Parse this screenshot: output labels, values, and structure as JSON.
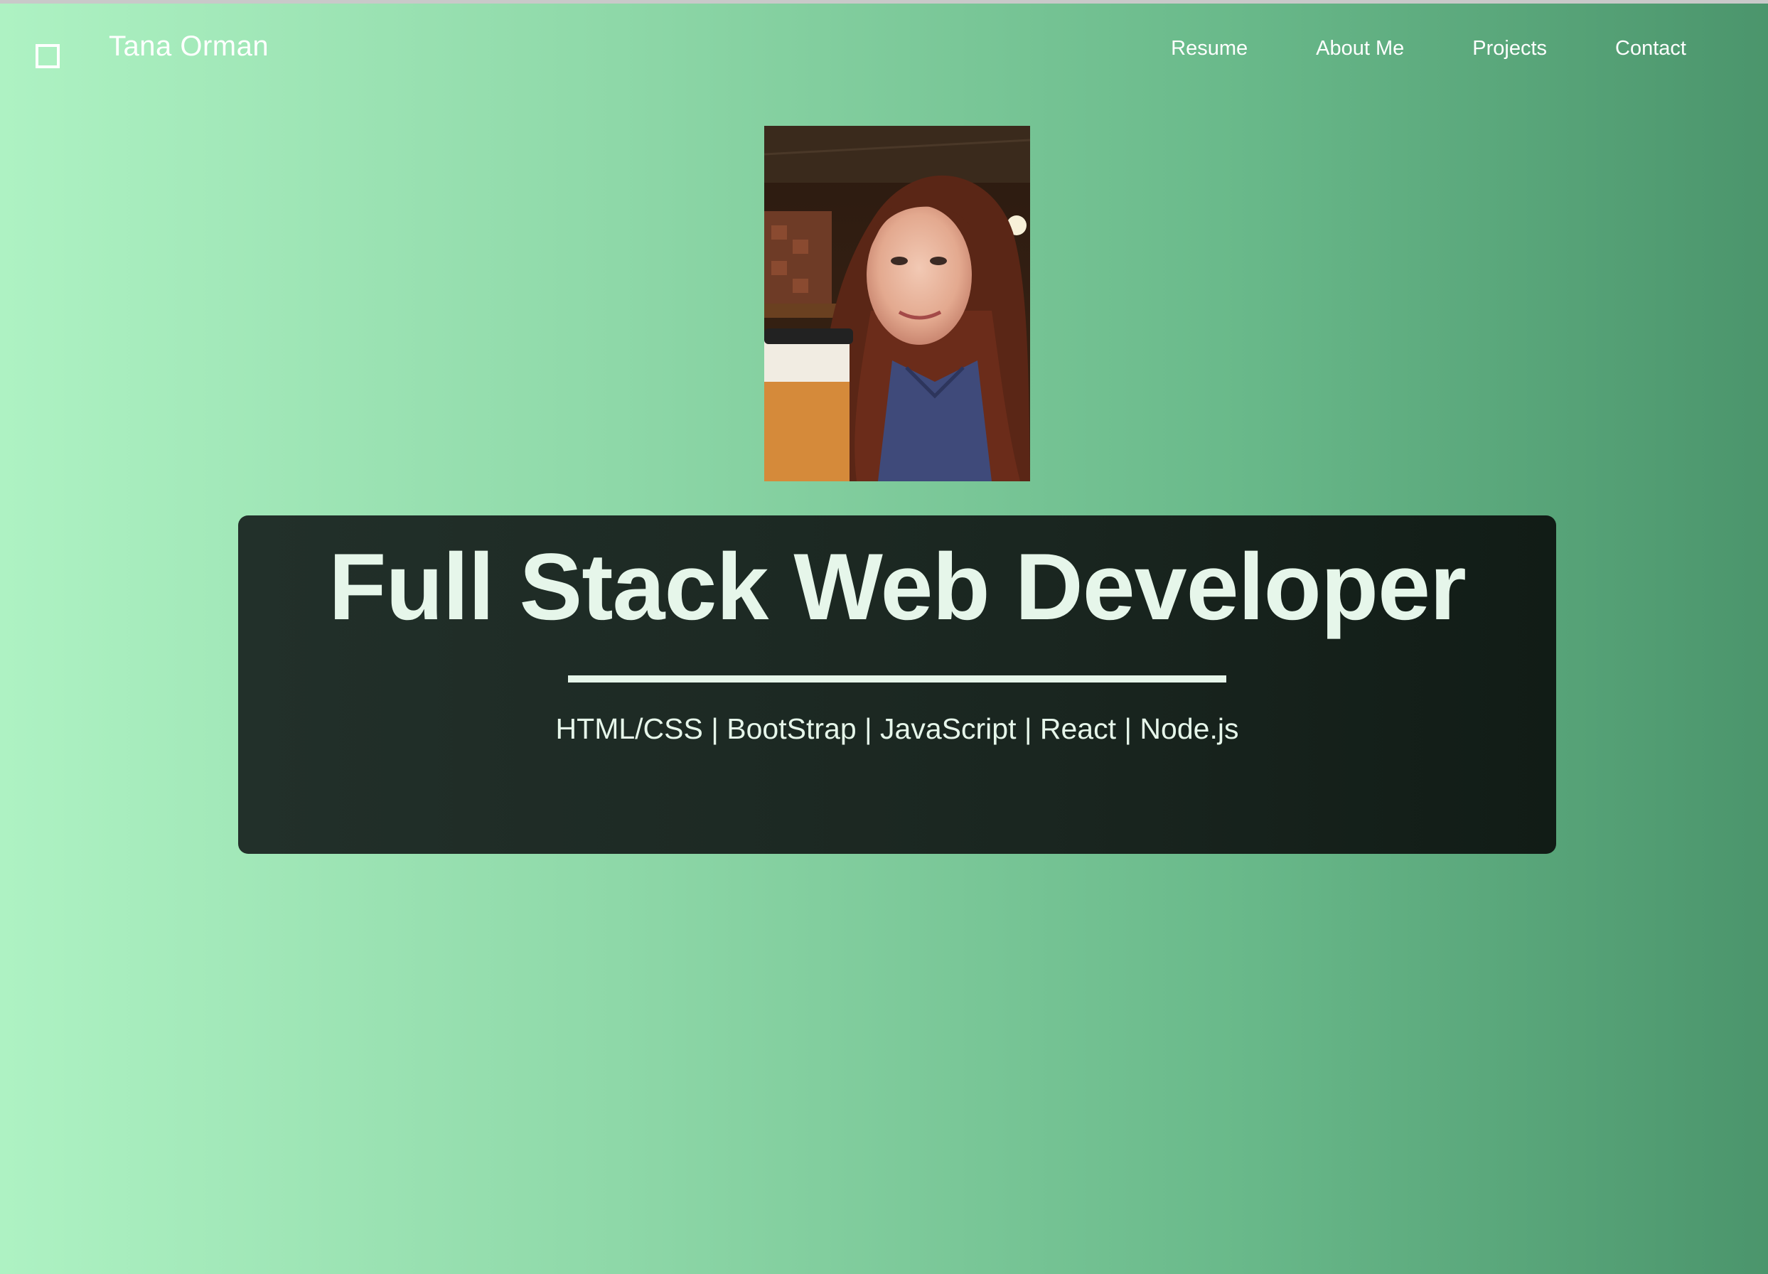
{
  "header": {
    "brand": "Tana Orman",
    "nav": [
      {
        "label": "Resume"
      },
      {
        "label": "About Me"
      },
      {
        "label": "Projects"
      },
      {
        "label": "Contact"
      }
    ]
  },
  "hero": {
    "title": "Full Stack Web Developer",
    "skills": "HTML/CSS | BootStrap | JavaScript | React | Node.js"
  },
  "colors": {
    "gradient_start": "#aef2c3",
    "gradient_end": "#4b956c",
    "panel": "#1a2620",
    "text_light": "#e6f6ea"
  },
  "icons": {
    "nav_toggle": "square-outline-icon"
  }
}
